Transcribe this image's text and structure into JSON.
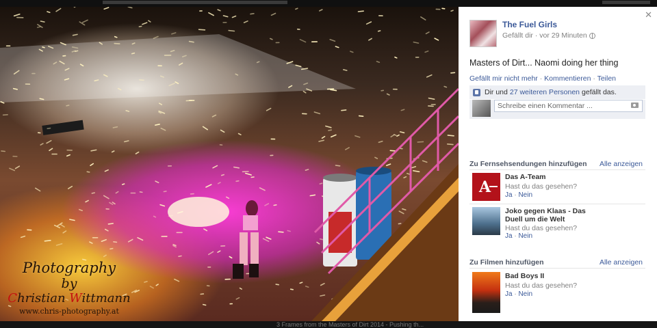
{
  "photo": {
    "watermark": {
      "line1": "Photography",
      "line2": "by",
      "line3_first": "C",
      "line3_a": "hristian ",
      "line3_second": "W",
      "line3_b": "ittmann",
      "line4": "www.chris-photography.at"
    },
    "caption_below": "3 Frames from the Masters of Dirt 2014 - Pushing th..."
  },
  "post": {
    "author": "The Fuel Girls",
    "meta": "Gefällt dir · vor 29 Minuten",
    "text": "Masters of Dirt... Naomi doing her thing",
    "actions": {
      "unlike": "Gefällt mir nicht mehr",
      "comment": "Kommentieren",
      "share": "Teilen"
    },
    "likes": {
      "prefix": "Dir und",
      "link": "27 weiteren Personen",
      "suffix": "gefällt das."
    },
    "comment_placeholder": "Schreibe einen Kommentar ..."
  },
  "tv_section": {
    "title": "Zu Fernsehsendungen hinzufügen",
    "see_all": "Alle anzeigen",
    "items": [
      {
        "title": "Das A-Team",
        "sub": "Hast du das gesehen?",
        "yes": "Ja",
        "no": "Nein"
      },
      {
        "title": "Joko gegen Klaas - Das Duell um die Welt",
        "sub": "Hast du das gesehen?",
        "yes": "Ja",
        "no": "Nein"
      }
    ]
  },
  "film_section": {
    "title": "Zu Filmen hinzufügen",
    "see_all": "Alle anzeigen",
    "items": [
      {
        "title": "Bad Boys II",
        "sub": "Hast du das gesehen?",
        "yes": "Ja",
        "no": "Nein"
      }
    ]
  },
  "colors": {
    "link": "#3b5998",
    "likes_bg": "#edeff4",
    "ateam_red": "#b3121a"
  }
}
